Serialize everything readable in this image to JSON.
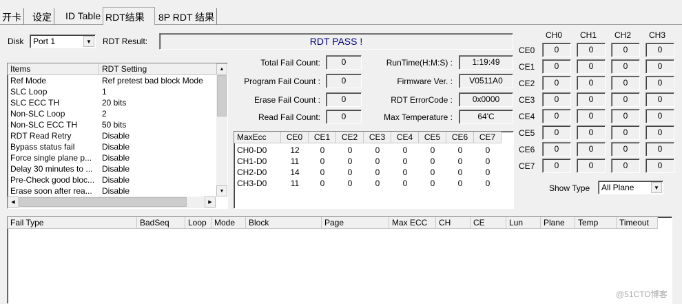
{
  "tabs": [
    {
      "label": "开卡"
    },
    {
      "label": "设定"
    },
    {
      "label": "ID Table"
    },
    {
      "label": "RDT结果"
    },
    {
      "label": "8P RDT 结果"
    }
  ],
  "disk": {
    "label": "Disk",
    "value": "Port 1"
  },
  "rdt_result": {
    "label": "RDT Result:",
    "value": "RDT PASS !"
  },
  "settings_table": {
    "headers": [
      "Items",
      "RDT Setting"
    ],
    "rows": [
      [
        "Ref Mode",
        "Ref pretest bad block Mode"
      ],
      [
        "SLC Loop",
        "1"
      ],
      [
        "SLC ECC TH",
        "20 bits"
      ],
      [
        "Non-SLC Loop",
        "2"
      ],
      [
        "Non-SLC ECC TH",
        "50 bits"
      ],
      [
        "RDT Read Retry",
        "Disable"
      ],
      [
        "Bypass status fail",
        "Disable"
      ],
      [
        "Force single plane p...",
        "Disable"
      ],
      [
        "Delay 30 minutes to ...",
        "Disable"
      ],
      [
        "Pre-Check good bloc...",
        "Disable"
      ],
      [
        "Erase soon after rea...",
        "Disable"
      ]
    ]
  },
  "fail_counts": {
    "total": {
      "label": "Total Fail Count:",
      "value": "0"
    },
    "program": {
      "label": "Program Fail Count :",
      "value": "0"
    },
    "erase": {
      "label": "Erase Fail Count :",
      "value": "0"
    },
    "read": {
      "label": "Read Fail Count:",
      "value": "0"
    }
  },
  "info": {
    "runtime": {
      "label": "RunTime(H:M:S) :",
      "value": "1:19:49"
    },
    "firmware": {
      "label": "Firmware Ver. :",
      "value": "V0511A0"
    },
    "error_code": {
      "label": "RDT ErrorCode :",
      "value": "0x0000"
    },
    "max_temp": {
      "label": "Max Temperature :",
      "value": "64'C"
    }
  },
  "maxecc_table": {
    "headers": [
      "MaxEcc",
      "CE0",
      "CE1",
      "CE2",
      "CE3",
      "CE4",
      "CE5",
      "CE6",
      "CE7"
    ],
    "rows": [
      [
        "CH0-D0",
        "12",
        "0",
        "0",
        "0",
        "0",
        "0",
        "0",
        "0"
      ],
      [
        "CH1-D0",
        "11",
        "0",
        "0",
        "0",
        "0",
        "0",
        "0",
        "0"
      ],
      [
        "CH2-D0",
        "14",
        "0",
        "0",
        "0",
        "0",
        "0",
        "0",
        "0"
      ],
      [
        "CH3-D0",
        "11",
        "0",
        "0",
        "0",
        "0",
        "0",
        "0",
        "0"
      ]
    ]
  },
  "grid": {
    "channels": [
      "CH0",
      "CH1",
      "CH2",
      "CH3"
    ],
    "ces": [
      "CE0",
      "CE1",
      "CE2",
      "CE3",
      "CE4",
      "CE5",
      "CE6",
      "CE7"
    ],
    "values": [
      [
        "0",
        "0",
        "0",
        "0"
      ],
      [
        "0",
        "0",
        "0",
        "0"
      ],
      [
        "0",
        "0",
        "0",
        "0"
      ],
      [
        "0",
        "0",
        "0",
        "0"
      ],
      [
        "0",
        "0",
        "0",
        "0"
      ],
      [
        "0",
        "0",
        "0",
        "0"
      ],
      [
        "0",
        "0",
        "0",
        "0"
      ],
      [
        "0",
        "0",
        "0",
        "0"
      ]
    ]
  },
  "show_type": {
    "label": "Show Type",
    "value": "All Plane"
  },
  "fail_table": {
    "headers": [
      "Fail Type",
      "BadSeq",
      "Loop",
      "Mode",
      "Block",
      "Page",
      "Max ECC",
      "CH",
      "CE",
      "Lun",
      "Plane",
      "Temp",
      "Timeout"
    ]
  },
  "watermark": "@51CTO博客"
}
